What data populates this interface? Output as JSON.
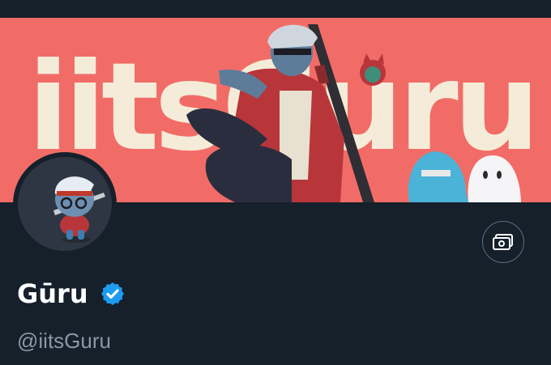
{
  "profile": {
    "banner_text": "iitsGuru",
    "display_name": "Gūru",
    "handle": "@iitsGuru",
    "verified": true
  },
  "icons": {
    "verified": "verified-badge-icon",
    "action": "banknote-icon"
  },
  "colors": {
    "background": "#15202b",
    "banner": "#f26c67",
    "banner_text": "#f4ecd8",
    "verified": "#1d9bf0",
    "handle": "#8b98a5"
  }
}
